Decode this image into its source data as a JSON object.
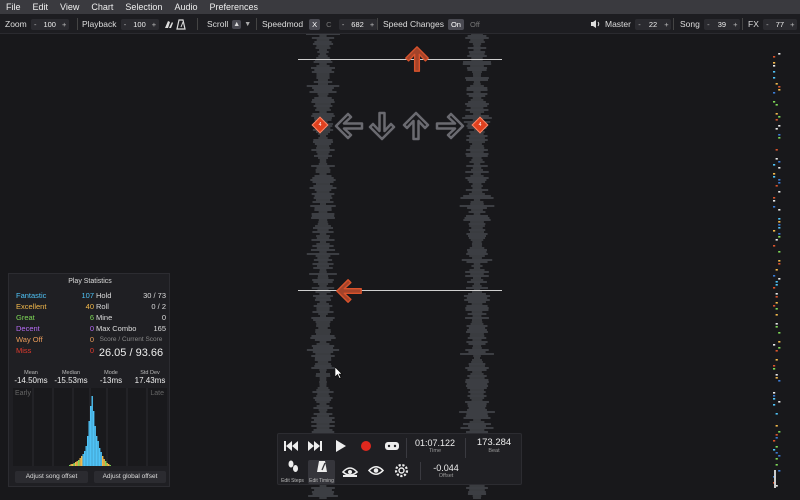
{
  "menu": [
    "File",
    "Edit",
    "View",
    "Chart",
    "Selection",
    "Audio",
    "Preferences"
  ],
  "toolbar": {
    "zoom_label": "Zoom",
    "zoom_value": "100",
    "playback_label": "Playback",
    "playback_value": "100",
    "scroll_label": "Scroll",
    "speedmod_label": "Speedmod",
    "speedmod_x": "X",
    "speedmod_c": "C",
    "speedmod_value": "682",
    "speed_changes_label": "Speed Changes",
    "speed_changes_on": "On",
    "speed_changes_off": "Off",
    "master_label": "Master",
    "master_value": "22",
    "song_label": "Song",
    "song_value": "39",
    "fx_label": "FX",
    "fx_value": "77",
    "stepper_minus": "-",
    "stepper_plus": "+"
  },
  "stats": {
    "title": "Play Statistics",
    "judgments": [
      {
        "label": "Fantastic",
        "value": "107",
        "color": "#4fc3f7"
      },
      {
        "label": "Excellent",
        "value": "40",
        "color": "#f2b84b"
      },
      {
        "label": "Great",
        "value": "6",
        "color": "#7ed957"
      },
      {
        "label": "Decent",
        "value": "0",
        "color": "#b66cf5"
      },
      {
        "label": "Way Off",
        "value": "0",
        "color": "#e89b5a"
      },
      {
        "label": "Miss",
        "value": "0",
        "color": "#e03a2e"
      }
    ],
    "counters": [
      {
        "label": "Hold",
        "value": "30 / 73"
      },
      {
        "label": "Roll",
        "value": "0 / 2"
      },
      {
        "label": "Mine",
        "value": "0"
      },
      {
        "label": "Max Combo",
        "value": "165"
      }
    ],
    "score_label": "Score / Current Score",
    "score_value": "26.05 / 93.66",
    "timing": [
      {
        "label": "Mean",
        "value": "-14.50ms"
      },
      {
        "label": "Median",
        "value": "-15.53ms"
      },
      {
        "label": "Mode",
        "value": "-13ms"
      },
      {
        "label": "Std Dev",
        "value": "17.43ms"
      }
    ],
    "early_label": "Early",
    "late_label": "Late",
    "adjust_song": "Adjust song offset",
    "adjust_global": "Adjust global offset"
  },
  "transport": {
    "time_value": "01:07.122",
    "time_label": "Time",
    "beat_value": "173.284",
    "beat_label": "Beat",
    "offset_value": "-0.044",
    "offset_label": "Offset",
    "edit_steps_label": "Edit Steps",
    "edit_timing_label": "Edit Timing"
  },
  "chart_area": {
    "receptor_directions": [
      "left",
      "down",
      "up",
      "right"
    ],
    "mine_label": "4",
    "notes": [
      {
        "direction": "up",
        "color": "#d9532c"
      },
      {
        "direction": "left",
        "color": "#d9532c"
      }
    ]
  },
  "colors": {
    "background": "#18181b",
    "menubar": "#3a3a3f",
    "note": "#d9532c",
    "mine": "#e0411f"
  }
}
